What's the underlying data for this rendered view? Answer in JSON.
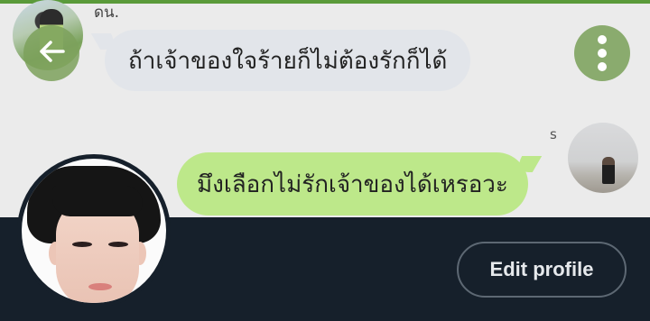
{
  "chat": {
    "incoming": {
      "sender_name": "ดน.",
      "message": "ถ้าเจ้าของใจร้ายก็ไม่ต้องรักก็ได้"
    },
    "outgoing": {
      "sender_name": "s",
      "message": "มึงเลือกไม่รักเจ้าของได้เหรอวะ"
    }
  },
  "icons": {
    "back": "arrow-left-icon",
    "menu": "more-vertical-icon"
  },
  "profile": {
    "edit_label": "Edit profile"
  },
  "colors": {
    "accent": "#5a9a3a",
    "incoming_bubble": "#e2e5ea",
    "outgoing_bubble": "#bde88a",
    "profile_bar": "#16202b"
  }
}
